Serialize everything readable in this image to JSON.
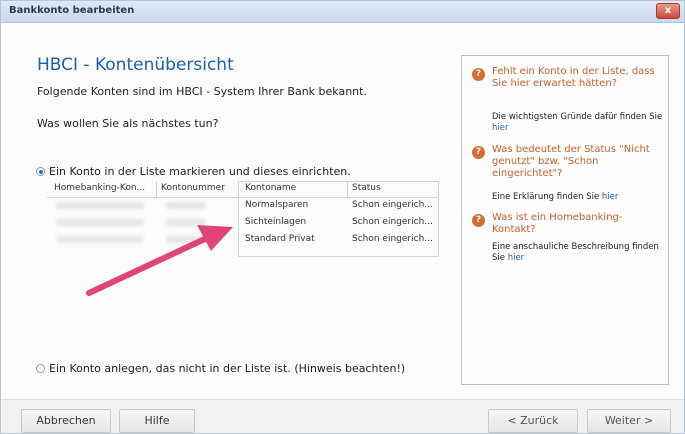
{
  "window": {
    "title": "Bankkonto bearbeiten",
    "close_label": "x"
  },
  "main": {
    "heading": "HBCI - Kontenübersicht",
    "intro": "Folgende Konten sind im HBCI - System Ihrer Bank bekannt.",
    "question": "Was wollen Sie als nächstes tun?",
    "option_select": "Ein Konto in der Liste markieren und dieses einrichten.",
    "option_create": "Ein Konto anlegen, das nicht in der Liste ist. (Hinweis beachten!)"
  },
  "table": {
    "columns": [
      "Homebanking-Kon...",
      "Kontonummer",
      "Kontoname",
      "Status"
    ],
    "rows": [
      {
        "kontoname": "Normalsparen",
        "status": "Schon eingerich..."
      },
      {
        "kontoname": "Sichteinlagen",
        "status": "Schon eingerich..."
      },
      {
        "kontoname": "Standard Privat",
        "status": "Schon eingerich..."
      }
    ]
  },
  "help": {
    "items": [
      {
        "question": "Fehlt ein Konto in der Liste, dass Sie hier erwartet hätten?",
        "answer": "Die wichtigsten Gründe dafür finden Sie",
        "link": "hier"
      },
      {
        "question": "Was bedeutet der Status \"Nicht genutzt\" bzw. \"Schon eingerichtet\"?",
        "answer": "Eine Erklärung finden Sie",
        "link": "hier"
      },
      {
        "question": "Was ist ein Homebanking-Kontakt?",
        "answer": "Eine anschauliche Beschreibung finden Sie",
        "link": "hier"
      }
    ]
  },
  "buttons": {
    "cancel": "Abbrechen",
    "help": "Hilfe",
    "back": "< Zurück",
    "next": "Weiter >"
  },
  "colors": {
    "heading": "#1f5fa8",
    "help_question": "#c0602a",
    "arrow": "#e0457a"
  }
}
